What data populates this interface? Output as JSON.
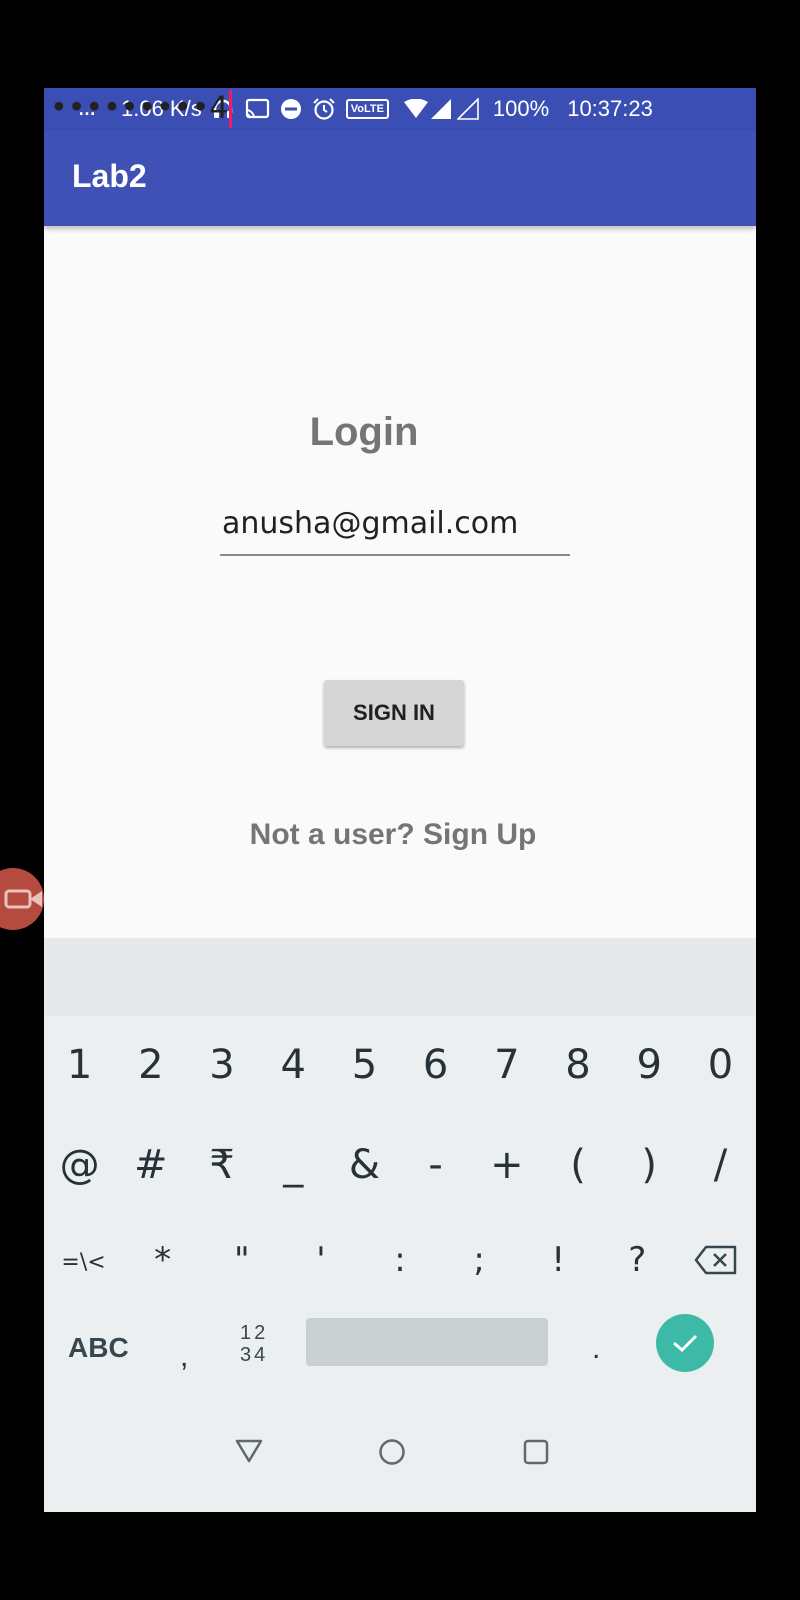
{
  "status_bar": {
    "dots": "…",
    "network_speed": "1.06 K/s",
    "volte": "VoLTE",
    "battery": "100%",
    "time": "10:37:23",
    "icons": [
      "headset-icon",
      "cast-icon",
      "do-not-disturb-icon",
      "alarm-icon",
      "wifi-icon",
      "signal-icon",
      "signal-empty-icon"
    ]
  },
  "app_bar": {
    "title": "Lab2",
    "color": "#3f51b5"
  },
  "login": {
    "title": "Login",
    "email_value": "anusha@gmail.com",
    "password_value": "•••••••••4",
    "signin_label": "SIGN IN",
    "signup_text": "Not a user? Sign Up",
    "accent_color": "#e91e63"
  },
  "keyboard": {
    "row1": [
      "1",
      "2",
      "3",
      "4",
      "5",
      "6",
      "7",
      "8",
      "9",
      "0"
    ],
    "row2": [
      "@",
      "#",
      "₹",
      "_",
      "&",
      "-",
      "+",
      "(",
      ")",
      "/"
    ],
    "row3": [
      "=\\<",
      "*",
      "\"",
      "'",
      ":",
      ";",
      "!",
      "?"
    ],
    "abc_label": "ABC",
    "comma": ",",
    "num_top": "12",
    "num_bottom": "34",
    "period": ".",
    "enter_color": "#3dbaa7"
  },
  "nav_bar": {
    "icons": [
      "back-icon",
      "home-icon",
      "recents-icon"
    ]
  }
}
